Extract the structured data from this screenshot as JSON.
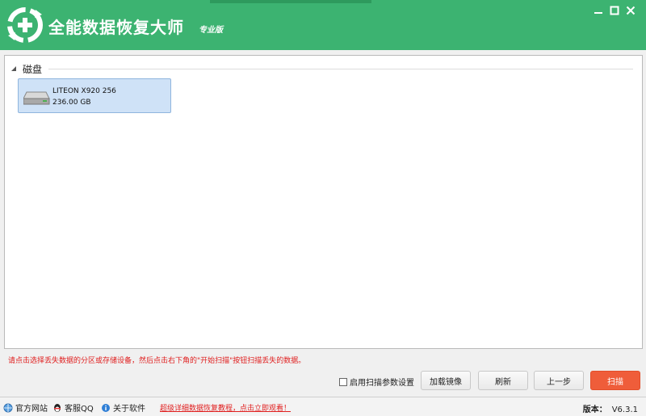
{
  "app": {
    "title": "全能数据恢复大师",
    "edition": "专业版"
  },
  "colors": {
    "titlebar": "#3cb371",
    "scan_button": "#ef5d3a",
    "hint_text": "#e02020",
    "disk_selected": "#cfe2f7"
  },
  "icons": {
    "logo": "recycle-arrows-plus-icon",
    "minimize": "minimize-icon",
    "maximize": "maximize-icon",
    "close": "close-icon",
    "disk": "hard-drive-icon",
    "website": "globe-icon",
    "support": "qq-penguin-icon",
    "about": "info-icon"
  },
  "disk_group": {
    "label": "磁盘",
    "disks": [
      {
        "name": "LITEON X920 256",
        "size": "236.00 GB"
      }
    ]
  },
  "hint": "请点击选择丢失数据的分区或存储设备，然后点击右下角的\"开始扫描\"按钮扫描丢失的数据。",
  "controls": {
    "scan_settings_label": "启用扫描参数设置",
    "load_image_label": "加载镜像",
    "refresh_label": "刷新",
    "back_label": "上一步",
    "scan_label": "扫描"
  },
  "statusbar": {
    "website": "官方网站",
    "support": "客服QQ",
    "about": "关于软件",
    "promo": "超级详细数据恢复教程，点击立即观看！",
    "version_label": "版本：",
    "version": "V6.3.1"
  }
}
